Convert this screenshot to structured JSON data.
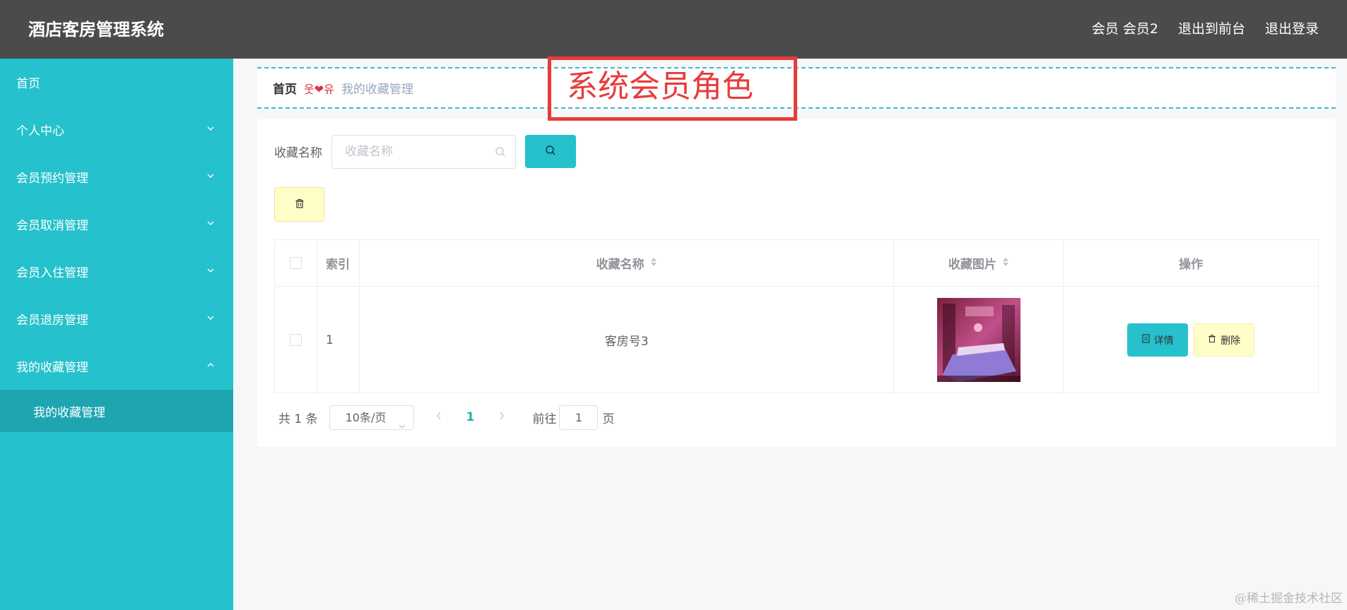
{
  "header": {
    "title": "酒店客房管理系统",
    "user_label": "会员 会员2",
    "front_label": "退出到前台",
    "logout_label": "退出登录"
  },
  "sidebar": {
    "items": [
      {
        "label": "首页",
        "expandable": false
      },
      {
        "label": "个人中心",
        "expandable": true,
        "expanded": false
      },
      {
        "label": "会员预约管理",
        "expandable": true,
        "expanded": false
      },
      {
        "label": "会员取消管理",
        "expandable": true,
        "expanded": false
      },
      {
        "label": "会员入住管理",
        "expandable": true,
        "expanded": false
      },
      {
        "label": "会员退房管理",
        "expandable": true,
        "expanded": false
      },
      {
        "label": "我的收藏管理",
        "expandable": true,
        "expanded": true
      }
    ],
    "sub_item": "我的收藏管理"
  },
  "breadcrumb": {
    "home": "首页",
    "separator": "웃❤유",
    "current": "我的收藏管理"
  },
  "annotation": {
    "text": "系统会员角色",
    "color": "#e83b3b"
  },
  "search": {
    "label": "收藏名称",
    "placeholder": "收藏名称",
    "value": ""
  },
  "table": {
    "columns": [
      "索引",
      "收藏名称",
      "收藏图片",
      "操作"
    ],
    "rows": [
      {
        "index": "1",
        "name": "客房号3",
        "detail_label": "详情",
        "delete_label": "删除"
      }
    ]
  },
  "pagination": {
    "total": "共 1 条",
    "page_size": "10条/页",
    "current_page": "1",
    "goto_label": "前往",
    "goto_value": "1",
    "page_suffix": "页"
  },
  "watermark": "@稀土掘金技术社区",
  "colors": {
    "header_bg": "#4b4b4b",
    "sidebar_bg": "#25c1cc",
    "sidebar_active": "#1ea5b0",
    "primary": "#25c1cc",
    "warning_light": "#fffec7"
  }
}
